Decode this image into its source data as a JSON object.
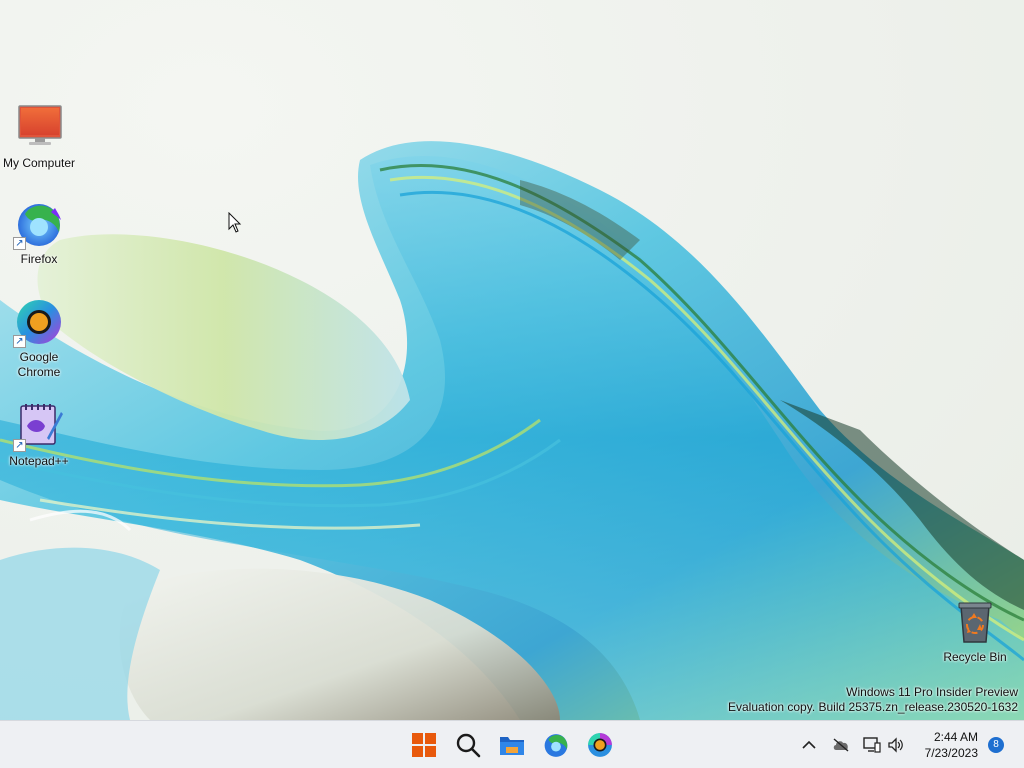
{
  "desktop": {
    "icons": [
      {
        "name": "my-computer",
        "label": "My Computer"
      },
      {
        "name": "firefox",
        "label": "Firefox"
      },
      {
        "name": "google-chrome",
        "label": "Google Chrome"
      },
      {
        "name": "notepad-plus-plus",
        "label": "Notepad++"
      },
      {
        "name": "recycle-bin",
        "label": "Recycle Bin"
      }
    ],
    "watermark": {
      "line1": "Windows 11 Pro Insider Preview",
      "line2": "Evaluation copy. Build 25375.zn_release.230520-1632"
    }
  },
  "taskbar": {
    "pinned": [
      "windows-start-icon",
      "search-icon",
      "file-explorer-icon",
      "firefox-icon",
      "chrome-icon"
    ],
    "tray": [
      "chevron-up-icon",
      "onedrive-offline-icon",
      "network-icon",
      "volume-icon"
    ],
    "clock": {
      "time": "2:44 AM",
      "date": "7/23/2023"
    },
    "notification_count": "8"
  },
  "colors": {
    "accent": "#1e6fd0",
    "taskbar_bg": "#eef0f3",
    "start_orange": "#e8590c"
  }
}
